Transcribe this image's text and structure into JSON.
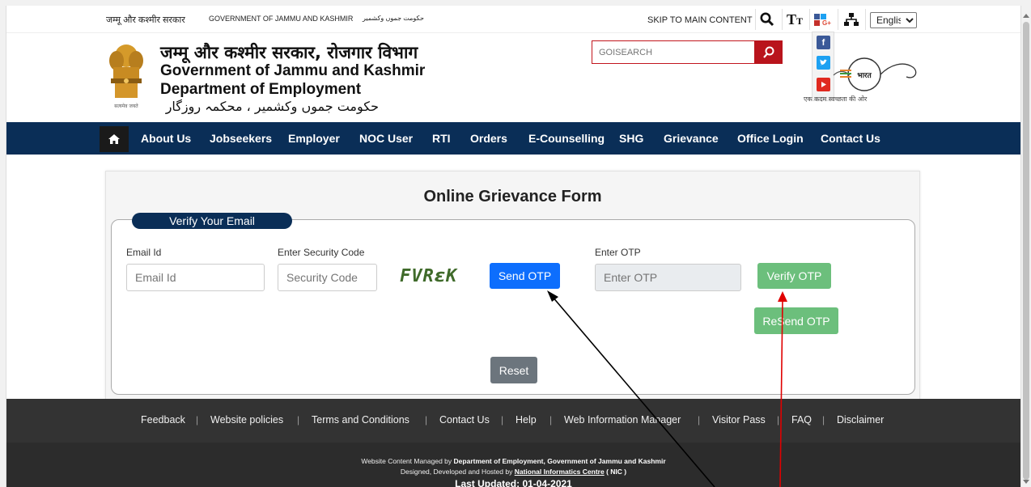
{
  "topbar": {
    "gov_hindi": "जम्मू और कश्मीर सरकार",
    "gov_english": "GOVERNMENT OF JAMMU AND KASHMIR",
    "gov_urdu": "حکومت جموں وکشمیر",
    "skip_link": "SKIP TO MAIN CONTENT",
    "language": "English",
    "icons": [
      "search-icon",
      "text-size-icon",
      "social-share-icon",
      "sitemap-icon"
    ]
  },
  "header": {
    "title_hindi": "जम्मू और कश्मीर सरकार, रोजगार विभाग",
    "title_english_1": "Government of Jammu and Kashmir",
    "title_english_2": "Department of Employment",
    "title_urdu": "حکومت جموں وکشمیر ، محکمہ روزگار",
    "emblem_caption": "सत्यमेव जयते",
    "search_placeholder": "GOISEARCH",
    "social": [
      "facebook-icon",
      "twitter-icon",
      "youtube-icon"
    ],
    "swachh_label": "भारत",
    "swachh_text": "एक कदम स्वच्छता की ओर"
  },
  "nav": {
    "items": [
      "About Us",
      "Jobseekers",
      "Employer",
      "NOC User",
      "RTI",
      "Orders",
      "E-Counselling",
      "SHG",
      "Grievance",
      "Office Login",
      "Contact Us"
    ]
  },
  "form": {
    "title": "Online Grievance Form",
    "legend": "Verify Your Email",
    "email_label": "Email Id",
    "email_placeholder": "Email Id",
    "security_label": "Enter Security Code",
    "security_placeholder": "Security Code",
    "captcha_text": "FVRɛK",
    "send_otp": "Send OTP",
    "otp_label": "Enter OTP",
    "otp_placeholder": "Enter OTP",
    "verify_otp": "Verify OTP",
    "resend_otp": "ReSend OTP",
    "reset": "Reset"
  },
  "footer": {
    "links": [
      "Feedback",
      "Website policies",
      "Terms and Conditions",
      "Contact Us",
      "Help",
      "Web Information Manager",
      "Visitor Pass",
      "FAQ",
      "Disclaimer"
    ],
    "managed_prefix": "Website Content Managed by",
    "managed_by": "Department of Employment, Government of Jammu and Kashmir",
    "hosted_prefix": "Designed, Developed and Hosted by",
    "hosted_by": "National Informatics Centre",
    "hosted_suffix": "( NIC )",
    "last_updated": "Last Updated: 01-04-2021"
  },
  "colors": {
    "nav_bg": "#0a2e57",
    "brand_red": "#b9141c",
    "send_btn": "#0d6efd",
    "verify_btn": "#6cbf7c",
    "reset_btn": "#6c757d",
    "annotation_black": "#000000",
    "annotation_red": "#e00000"
  }
}
